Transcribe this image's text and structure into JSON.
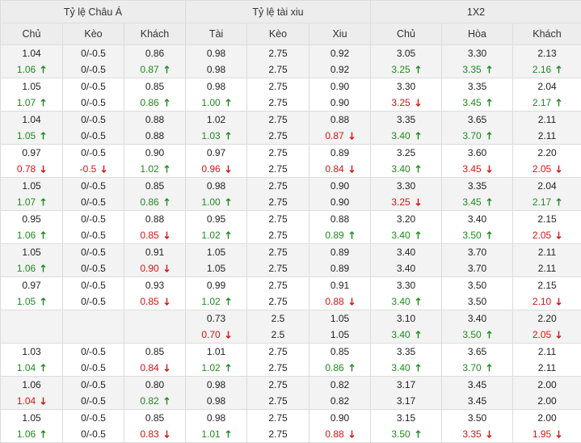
{
  "header": {
    "groups": [
      "Tỷ lệ Châu Á",
      "Tỷ lệ tài xiu",
      "1X2"
    ],
    "columns": [
      "Chủ",
      "Kèo",
      "Khách",
      "Tài",
      "Kèo",
      "Xiu",
      "Chủ",
      "Hòa",
      "Khách"
    ]
  },
  "colors": {
    "up": "#1f8a1f",
    "down": "#d41515",
    "header_bg": "#ededed",
    "alt_row_bg": "#f3f3f3"
  },
  "icons": {
    "up": "arrow-up-icon",
    "down": "arrow-down-icon"
  },
  "rows": [
    {
      "shaded": true,
      "cells": [
        [
          {
            "t": "1.04"
          },
          {
            "t": "1.06",
            "d": "up"
          }
        ],
        [
          {
            "t": "0/-0.5"
          },
          {
            "t": "0/-0.5"
          }
        ],
        [
          {
            "t": "0.86"
          },
          {
            "t": "0.87",
            "d": "up"
          }
        ],
        [
          {
            "t": "0.98"
          },
          {
            "t": "0.98"
          }
        ],
        [
          {
            "t": "2.75"
          },
          {
            "t": "2.75"
          }
        ],
        [
          {
            "t": "0.92"
          },
          {
            "t": "0.92"
          }
        ],
        [
          {
            "t": "3.05"
          },
          {
            "t": "3.25",
            "d": "up"
          }
        ],
        [
          {
            "t": "3.30"
          },
          {
            "t": "3.35",
            "d": "up"
          }
        ],
        [
          {
            "t": "2.13"
          },
          {
            "t": "2.16",
            "d": "up"
          }
        ]
      ]
    },
    {
      "shaded": false,
      "cells": [
        [
          {
            "t": "1.05"
          },
          {
            "t": "1.07",
            "d": "up"
          }
        ],
        [
          {
            "t": "0/-0.5"
          },
          {
            "t": "0/-0.5"
          }
        ],
        [
          {
            "t": "0.85"
          },
          {
            "t": "0.86",
            "d": "up"
          }
        ],
        [
          {
            "t": "0.98"
          },
          {
            "t": "1.00",
            "d": "up"
          }
        ],
        [
          {
            "t": "2.75"
          },
          {
            "t": "2.75"
          }
        ],
        [
          {
            "t": "0.90"
          },
          {
            "t": "0.90"
          }
        ],
        [
          {
            "t": "3.30"
          },
          {
            "t": "3.25",
            "d": "down"
          }
        ],
        [
          {
            "t": "3.35"
          },
          {
            "t": "3.45",
            "d": "up"
          }
        ],
        [
          {
            "t": "2.04"
          },
          {
            "t": "2.17",
            "d": "up"
          }
        ]
      ]
    },
    {
      "shaded": true,
      "cells": [
        [
          {
            "t": "1.04"
          },
          {
            "t": "1.05",
            "d": "up"
          }
        ],
        [
          {
            "t": "0/-0.5"
          },
          {
            "t": "0/-0.5"
          }
        ],
        [
          {
            "t": "0.88"
          },
          {
            "t": "0.88"
          }
        ],
        [
          {
            "t": "1.02"
          },
          {
            "t": "1.03",
            "d": "up"
          }
        ],
        [
          {
            "t": "2.75"
          },
          {
            "t": "2.75"
          }
        ],
        [
          {
            "t": "0.88"
          },
          {
            "t": "0.87",
            "d": "down"
          }
        ],
        [
          {
            "t": "3.35"
          },
          {
            "t": "3.40",
            "d": "up"
          }
        ],
        [
          {
            "t": "3.65"
          },
          {
            "t": "3.70",
            "d": "up"
          }
        ],
        [
          {
            "t": "2.11"
          },
          {
            "t": "2.11"
          }
        ]
      ]
    },
    {
      "shaded": false,
      "cells": [
        [
          {
            "t": "0.97"
          },
          {
            "t": "0.78",
            "d": "down"
          }
        ],
        [
          {
            "t": "0/-0.5"
          },
          {
            "t": "-0.5",
            "d": "down"
          }
        ],
        [
          {
            "t": "0.90"
          },
          {
            "t": "1.02",
            "d": "up"
          }
        ],
        [
          {
            "t": "0.97"
          },
          {
            "t": "0.96",
            "d": "down"
          }
        ],
        [
          {
            "t": "2.75"
          },
          {
            "t": "2.75"
          }
        ],
        [
          {
            "t": "0.89"
          },
          {
            "t": "0.84",
            "d": "down"
          }
        ],
        [
          {
            "t": "3.25"
          },
          {
            "t": "3.40",
            "d": "up"
          }
        ],
        [
          {
            "t": "3.60"
          },
          {
            "t": "3.45",
            "d": "down"
          }
        ],
        [
          {
            "t": "2.20"
          },
          {
            "t": "2.05",
            "d": "down"
          }
        ]
      ]
    },
    {
      "shaded": true,
      "cells": [
        [
          {
            "t": "1.05"
          },
          {
            "t": "1.07",
            "d": "up"
          }
        ],
        [
          {
            "t": "0/-0.5"
          },
          {
            "t": "0/-0.5"
          }
        ],
        [
          {
            "t": "0.85"
          },
          {
            "t": "0.86",
            "d": "up"
          }
        ],
        [
          {
            "t": "0.98"
          },
          {
            "t": "1.00",
            "d": "up"
          }
        ],
        [
          {
            "t": "2.75"
          },
          {
            "t": "2.75"
          }
        ],
        [
          {
            "t": "0.90"
          },
          {
            "t": "0.90"
          }
        ],
        [
          {
            "t": "3.30"
          },
          {
            "t": "3.25",
            "d": "down"
          }
        ],
        [
          {
            "t": "3.35"
          },
          {
            "t": "3.45",
            "d": "up"
          }
        ],
        [
          {
            "t": "2.04"
          },
          {
            "t": "2.17",
            "d": "up"
          }
        ]
      ]
    },
    {
      "shaded": false,
      "cells": [
        [
          {
            "t": "0.95"
          },
          {
            "t": "1.06",
            "d": "up"
          }
        ],
        [
          {
            "t": "0/-0.5"
          },
          {
            "t": "0/-0.5"
          }
        ],
        [
          {
            "t": "0.88"
          },
          {
            "t": "0.85",
            "d": "down"
          }
        ],
        [
          {
            "t": "0.95"
          },
          {
            "t": "1.02",
            "d": "up"
          }
        ],
        [
          {
            "t": "2.75"
          },
          {
            "t": "2.75"
          }
        ],
        [
          {
            "t": "0.88"
          },
          {
            "t": "0.89",
            "d": "up"
          }
        ],
        [
          {
            "t": "3.20"
          },
          {
            "t": "3.40",
            "d": "up"
          }
        ],
        [
          {
            "t": "3.40"
          },
          {
            "t": "3.50",
            "d": "up"
          }
        ],
        [
          {
            "t": "2.15"
          },
          {
            "t": "2.05",
            "d": "down"
          }
        ]
      ]
    },
    {
      "shaded": true,
      "cells": [
        [
          {
            "t": "1.05"
          },
          {
            "t": "1.06",
            "d": "up"
          }
        ],
        [
          {
            "t": "0/-0.5"
          },
          {
            "t": "0/-0.5"
          }
        ],
        [
          {
            "t": "0.91"
          },
          {
            "t": "0.90",
            "d": "down"
          }
        ],
        [
          {
            "t": "1.05"
          },
          {
            "t": "1.05"
          }
        ],
        [
          {
            "t": "2.75"
          },
          {
            "t": "2.75"
          }
        ],
        [
          {
            "t": "0.89"
          },
          {
            "t": "0.89"
          }
        ],
        [
          {
            "t": "3.40"
          },
          {
            "t": "3.40"
          }
        ],
        [
          {
            "t": "3.70"
          },
          {
            "t": "3.70"
          }
        ],
        [
          {
            "t": "2.11"
          },
          {
            "t": "2.11"
          }
        ]
      ]
    },
    {
      "shaded": false,
      "cells": [
        [
          {
            "t": "0.97"
          },
          {
            "t": "1.05",
            "d": "up"
          }
        ],
        [
          {
            "t": "0/-0.5"
          },
          {
            "t": "0/-0.5"
          }
        ],
        [
          {
            "t": "0.93"
          },
          {
            "t": "0.85",
            "d": "down"
          }
        ],
        [
          {
            "t": "0.99"
          },
          {
            "t": "1.02",
            "d": "up"
          }
        ],
        [
          {
            "t": "2.75"
          },
          {
            "t": "2.75"
          }
        ],
        [
          {
            "t": "0.91"
          },
          {
            "t": "0.88",
            "d": "down"
          }
        ],
        [
          {
            "t": "3.30"
          },
          {
            "t": "3.40",
            "d": "up"
          }
        ],
        [
          {
            "t": "3.50"
          },
          {
            "t": "3.50"
          }
        ],
        [
          {
            "t": "2.15"
          },
          {
            "t": "2.10",
            "d": "down"
          }
        ]
      ]
    },
    {
      "shaded": true,
      "cells": [
        [
          {
            "t": ""
          },
          {
            "t": ""
          }
        ],
        [
          {
            "t": ""
          },
          {
            "t": ""
          }
        ],
        [
          {
            "t": ""
          },
          {
            "t": ""
          }
        ],
        [
          {
            "t": "0.73"
          },
          {
            "t": "0.70",
            "d": "down"
          }
        ],
        [
          {
            "t": "2.5"
          },
          {
            "t": "2.5"
          }
        ],
        [
          {
            "t": "1.05"
          },
          {
            "t": "1.05"
          }
        ],
        [
          {
            "t": "3.10"
          },
          {
            "t": "3.40",
            "d": "up"
          }
        ],
        [
          {
            "t": "3.40"
          },
          {
            "t": "3.50",
            "d": "up"
          }
        ],
        [
          {
            "t": "2.20"
          },
          {
            "t": "2.05",
            "d": "down"
          }
        ]
      ]
    },
    {
      "shaded": false,
      "cells": [
        [
          {
            "t": "1.03"
          },
          {
            "t": "1.04",
            "d": "up"
          }
        ],
        [
          {
            "t": "0/-0.5"
          },
          {
            "t": "0/-0.5"
          }
        ],
        [
          {
            "t": "0.85"
          },
          {
            "t": "0.84",
            "d": "down"
          }
        ],
        [
          {
            "t": "1.01"
          },
          {
            "t": "1.02",
            "d": "up"
          }
        ],
        [
          {
            "t": "2.75"
          },
          {
            "t": "2.75"
          }
        ],
        [
          {
            "t": "0.85"
          },
          {
            "t": "0.86",
            "d": "up"
          }
        ],
        [
          {
            "t": "3.35"
          },
          {
            "t": "3.40",
            "d": "up"
          }
        ],
        [
          {
            "t": "3.65"
          },
          {
            "t": "3.70",
            "d": "up"
          }
        ],
        [
          {
            "t": "2.11"
          },
          {
            "t": "2.11"
          }
        ]
      ]
    },
    {
      "shaded": true,
      "cells": [
        [
          {
            "t": "1.06"
          },
          {
            "t": "1.04",
            "d": "down"
          }
        ],
        [
          {
            "t": "0/-0.5"
          },
          {
            "t": "0/-0.5"
          }
        ],
        [
          {
            "t": "0.80"
          },
          {
            "t": "0.82",
            "d": "up"
          }
        ],
        [
          {
            "t": "0.98"
          },
          {
            "t": "0.98"
          }
        ],
        [
          {
            "t": "2.75"
          },
          {
            "t": "2.75"
          }
        ],
        [
          {
            "t": "0.82"
          },
          {
            "t": "0.82"
          }
        ],
        [
          {
            "t": "3.17"
          },
          {
            "t": "3.17"
          }
        ],
        [
          {
            "t": "3.45"
          },
          {
            "t": "3.45"
          }
        ],
        [
          {
            "t": "2.00"
          },
          {
            "t": "2.00"
          }
        ]
      ]
    },
    {
      "shaded": false,
      "cells": [
        [
          {
            "t": "1.05"
          },
          {
            "t": "1.06",
            "d": "up"
          }
        ],
        [
          {
            "t": "0/-0.5"
          },
          {
            "t": "0/-0.5"
          }
        ],
        [
          {
            "t": "0.85"
          },
          {
            "t": "0.83",
            "d": "down"
          }
        ],
        [
          {
            "t": "0.98"
          },
          {
            "t": "1.01",
            "d": "up"
          }
        ],
        [
          {
            "t": "2.75"
          },
          {
            "t": "2.75"
          }
        ],
        [
          {
            "t": "0.90"
          },
          {
            "t": "0.88",
            "d": "down"
          }
        ],
        [
          {
            "t": "3.15"
          },
          {
            "t": "3.50",
            "d": "up"
          }
        ],
        [
          {
            "t": "3.50"
          },
          {
            "t": "3.35",
            "d": "down"
          }
        ],
        [
          {
            "t": "2.00"
          },
          {
            "t": "1.95",
            "d": "down"
          }
        ]
      ]
    }
  ]
}
